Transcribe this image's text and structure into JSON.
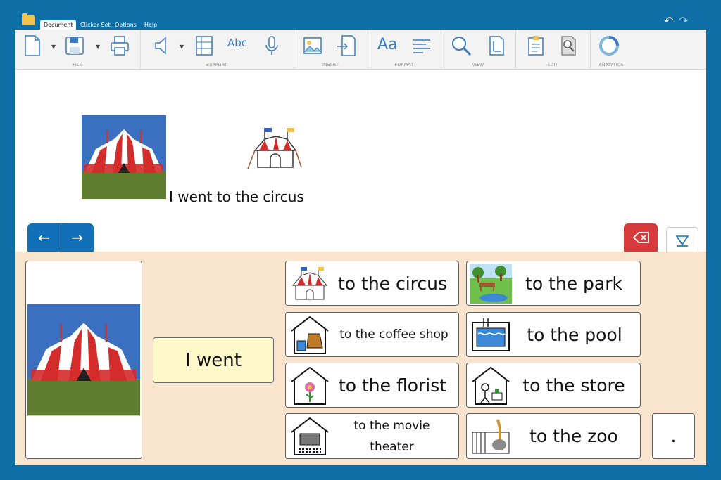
{
  "menu": {
    "tabs": [
      "Document",
      "Clicker Set",
      "Options",
      "Help"
    ],
    "active_tab": "Document"
  },
  "ribbon": {
    "groups": [
      "FILE",
      "SUPPORT",
      "INSERT",
      "FORMAT",
      "VIEW",
      "EDIT",
      "ANALYTICS"
    ],
    "format_icon_text": "Aa",
    "spell_icon_text": "Abc"
  },
  "document": {
    "sentence": "I went to the circus"
  },
  "grid": {
    "starter": "I went",
    "cells": [
      {
        "label": "to the circus",
        "icon": "circus-tent-icon"
      },
      {
        "label": "to the park",
        "icon": "park-icon"
      },
      {
        "label": "to the coffee shop",
        "icon": "coffee-shop-icon"
      },
      {
        "label": "to the pool",
        "icon": "pool-icon"
      },
      {
        "label": "to the florist",
        "icon": "florist-icon"
      },
      {
        "label": "to the store",
        "icon": "store-icon"
      },
      {
        "label": "to the movie theater",
        "icon": "movie-theater-icon"
      },
      {
        "label": "to the zoo",
        "icon": "zoo-icon"
      }
    ],
    "period": "."
  },
  "colors": {
    "frame": "#0e6fa7",
    "panel": "#f9e4cd",
    "nav": "#1170b8",
    "delete": "#d63a3a",
    "starter_bg": "#fff9c9"
  }
}
